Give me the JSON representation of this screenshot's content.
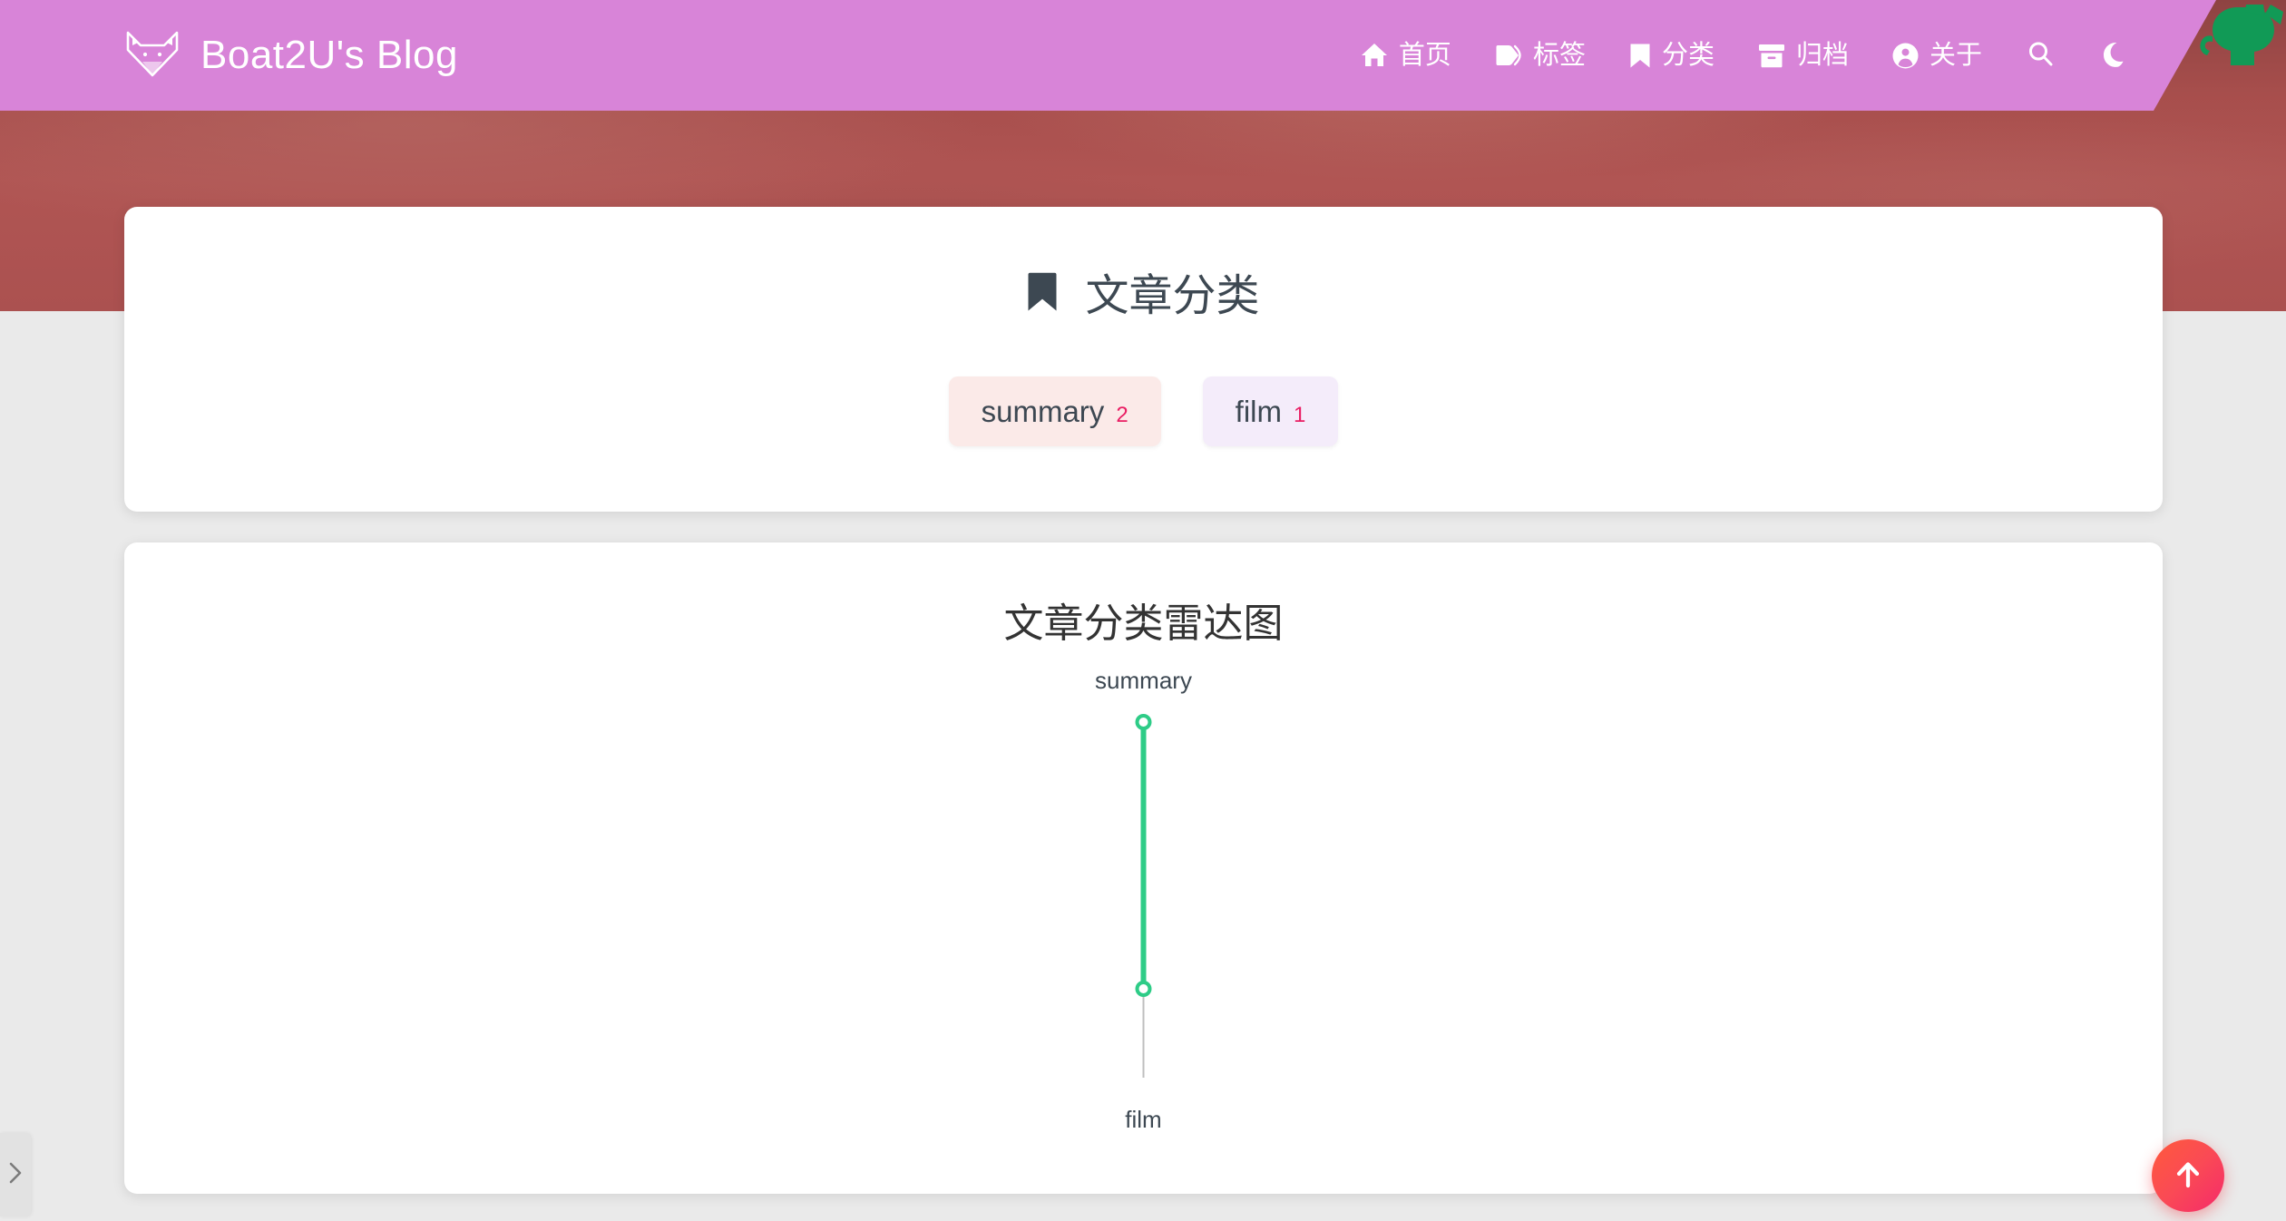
{
  "site": {
    "brand_title": "Boat2U's Blog",
    "logo_icon": "fox-head-icon",
    "header_color": "#d884d8",
    "corner_icon": "octocat-corner-icon"
  },
  "nav": {
    "items": [
      {
        "label": "首页",
        "icon": "home-icon",
        "name": "nav-item-home"
      },
      {
        "label": "标签",
        "icon": "tag-icon",
        "name": "nav-item-tags"
      },
      {
        "label": "分类",
        "icon": "bookmark-icon",
        "name": "nav-item-categories"
      },
      {
        "label": "归档",
        "icon": "archive-icon",
        "name": "nav-item-archive"
      },
      {
        "label": "关于",
        "icon": "user-circle-icon",
        "name": "nav-item-about"
      }
    ],
    "search_icon": "search-icon",
    "dark_mode_icon": "moon-icon"
  },
  "categories_card": {
    "title": "文章分类",
    "title_icon": "bookmark-icon",
    "chips": [
      {
        "name": "summary",
        "count": "2",
        "bg": "#fbeae8",
        "count_color": "#e91e63"
      },
      {
        "name": "film",
        "count": "1",
        "bg": "#f4ecfa",
        "count_color": "#e91e63"
      }
    ]
  },
  "radar_card": {
    "title": "文章分类雷达图"
  },
  "chart_data": {
    "type": "radar",
    "title": "文章分类雷达图",
    "categories": [
      "summary",
      "film"
    ],
    "values": [
      2,
      1
    ],
    "max": 2,
    "series": [
      {
        "name": "文章分类",
        "values": [
          2,
          1
        ],
        "line_color": "#2ecc87",
        "point_color": "#2ecc87"
      }
    ],
    "axis_color": "#bfbfbf",
    "label_color": "#3d4852",
    "legend": "none",
    "grid": false
  },
  "controls": {
    "sidebar_toggle_icon": "chevron-right-icon",
    "back_to_top_icon": "arrow-up-icon"
  }
}
